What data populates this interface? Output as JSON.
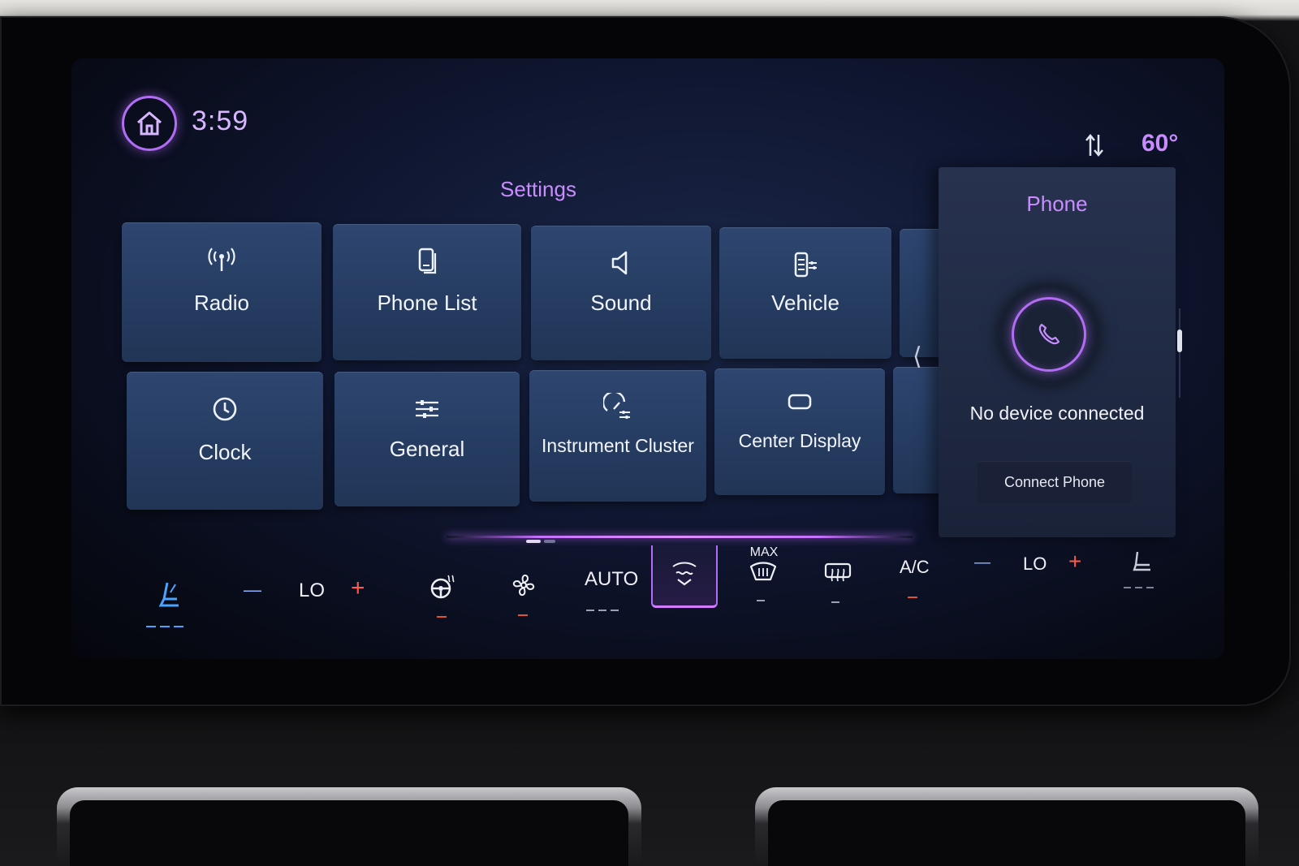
{
  "header": {
    "time": "3:59",
    "temperature": "60°",
    "home_icon": "home-icon",
    "sort_icon": "sort-arrows-icon"
  },
  "settings": {
    "title": "Settings",
    "tiles": [
      {
        "label": "Radio",
        "icon": "radio-antenna-icon"
      },
      {
        "label": "Phone List",
        "icon": "phone-device-icon"
      },
      {
        "label": "Sound",
        "icon": "speaker-icon"
      },
      {
        "label": "Vehicle",
        "icon": "vehicle-settings-icon"
      },
      {
        "label": "Clock",
        "icon": "clock-icon"
      },
      {
        "label": "General",
        "icon": "sliders-icon"
      },
      {
        "label": "Instrument Cluster",
        "icon": "gauge-icon"
      },
      {
        "label": "Center Display",
        "icon": "display-icon"
      }
    ],
    "scroll_back_glyph": "⟨"
  },
  "phone": {
    "title": "Phone",
    "status": "No device connected",
    "connect_label": "Connect Phone",
    "icon": "phone-handset-icon"
  },
  "climate": {
    "driver_temp_minus": "—",
    "driver_temp": "LO",
    "driver_temp_plus": "+",
    "auto_label": "AUTO",
    "max_label": "MAX",
    "ac_label": "A/C",
    "passenger_temp_minus": "—",
    "passenger_temp": "LO",
    "passenger_temp_plus": "+"
  },
  "colors": {
    "accent": "#b36cf5",
    "heater_on": "#e0542e",
    "seat_active": "#4aa3ff"
  }
}
